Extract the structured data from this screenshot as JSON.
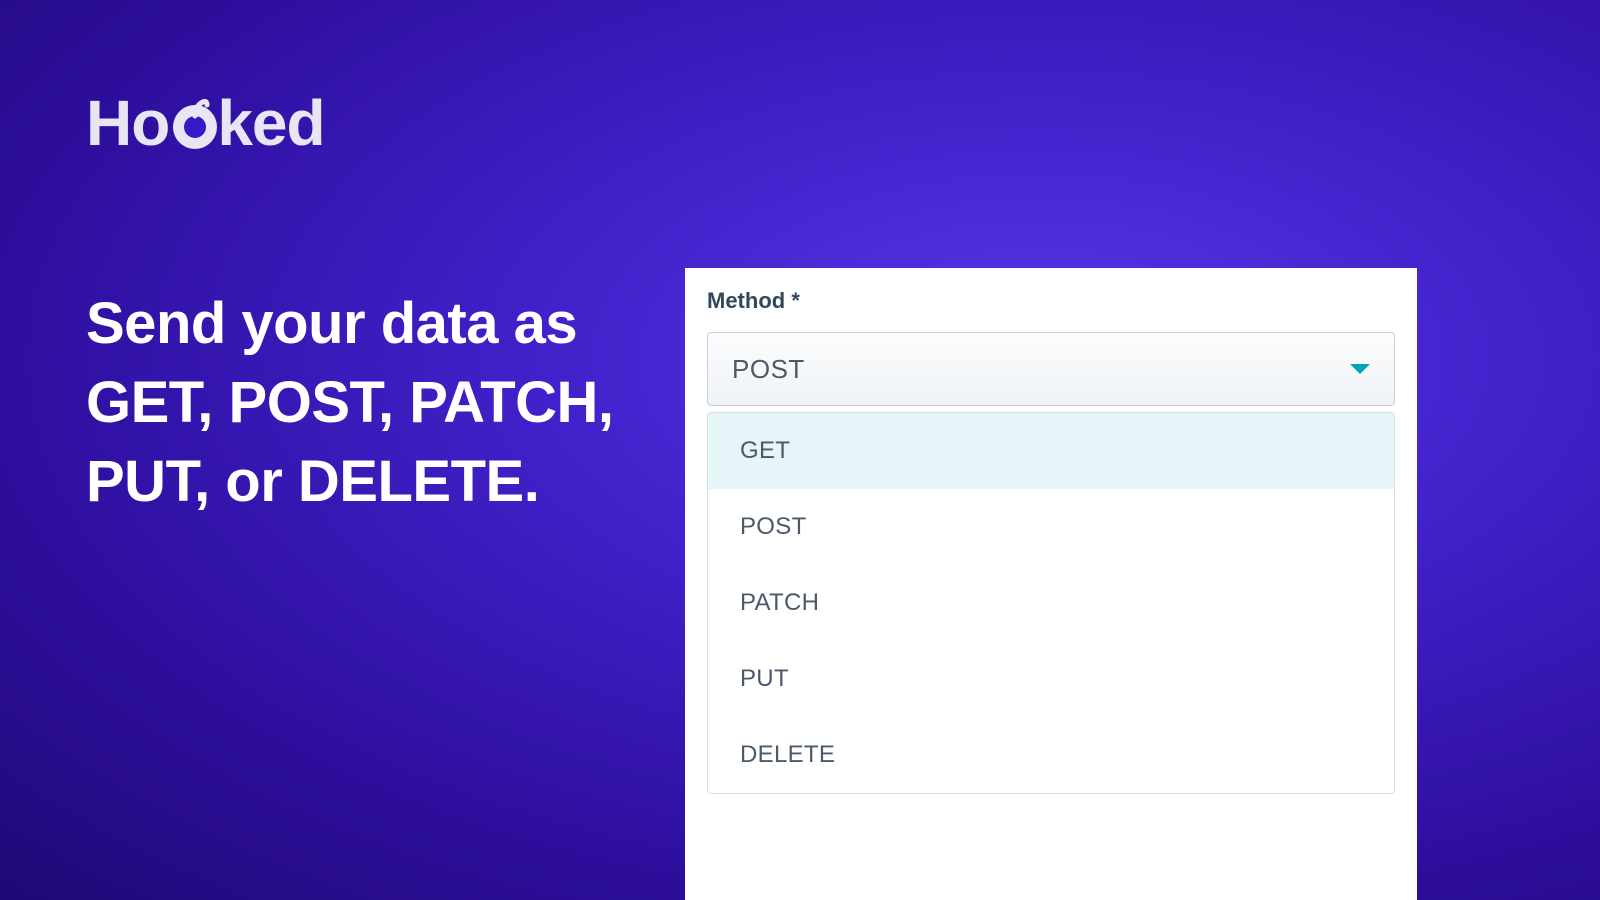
{
  "brand": {
    "name_part1": "Ho",
    "name_part2": "ked"
  },
  "headline": "Send your data as GET, POST, PATCH, PUT, or DELETE.",
  "form": {
    "method_label": "Method *",
    "method_selected": "POST",
    "method_options": [
      "GET",
      "POST",
      "PATCH",
      "PUT",
      "DELETE"
    ],
    "highlighted_index": 0
  },
  "colors": {
    "bg_gradient_inner": "#5838e8",
    "bg_gradient_outer": "#1f0875",
    "accent_teal": "#00a4bd",
    "text_dark": "#33475b",
    "text_muted": "#4a5a6a",
    "option_highlight": "#e5f5f8"
  }
}
